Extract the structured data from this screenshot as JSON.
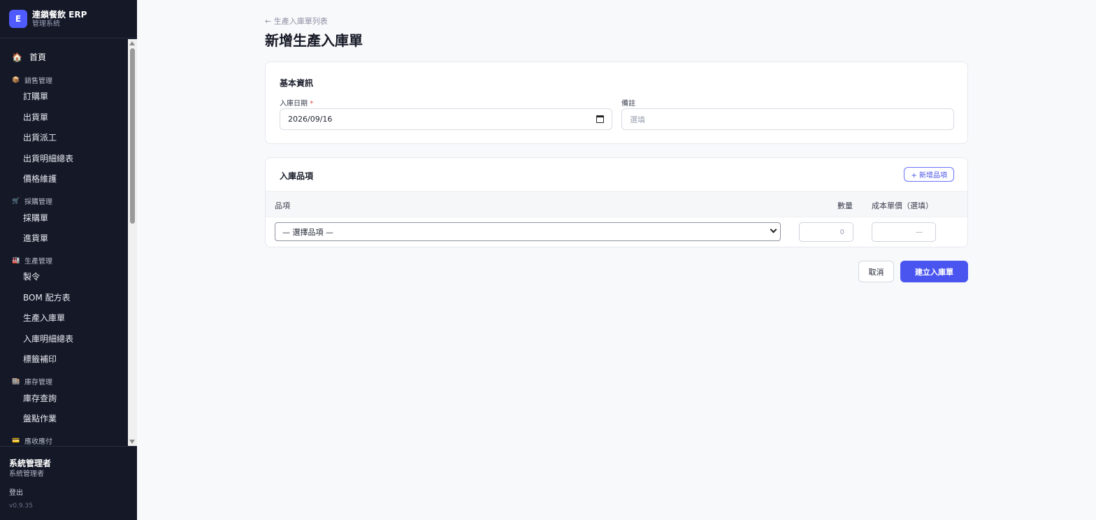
{
  "brand": {
    "logo": "E",
    "title": "連鎖餐飲 ERP",
    "subtitle": "管理系統"
  },
  "nav": {
    "home": {
      "icon": "home-icon",
      "label": "首頁"
    },
    "groups": [
      {
        "icon": "box-icon",
        "label": "銷售管理",
        "items": [
          "訂購單",
          "出貨單",
          "出貨派工",
          "出貨明細總表",
          "價格維護"
        ]
      },
      {
        "icon": "cart-icon",
        "label": "採購管理",
        "items": [
          "採購單",
          "進貨單"
        ]
      },
      {
        "icon": "factory-icon",
        "label": "生產管理",
        "items": [
          "製令",
          "BOM 配方表",
          "生產入庫單",
          "入庫明細總表",
          "標籤補印"
        ]
      },
      {
        "icon": "warehouse-icon",
        "label": "庫存管理",
        "items": [
          "庫存查詢",
          "盤點作業"
        ]
      },
      {
        "icon": "card-icon",
        "label": "應收應付",
        "items": []
      }
    ]
  },
  "user": {
    "name": "系統管理者",
    "role": "系統管理者",
    "logout": "登出",
    "version": "v0.9.35"
  },
  "header": {
    "back": "← 生產入庫單列表",
    "title": "新增生產入庫單"
  },
  "basic": {
    "title": "基本資訊",
    "date_label": "入庫日期",
    "required_mark": "*",
    "date_value": "2026/09/16",
    "note_label": "備註",
    "note_placeholder": "選填"
  },
  "items": {
    "title": "入庫品項",
    "add_button": "+ 新增品項",
    "columns": {
      "item": "品項",
      "qty": "數量",
      "cost": "成本單價（選填）"
    },
    "row": {
      "item_select": "— 選擇品項 —",
      "qty_placeholder": "0",
      "cost_placeholder": "—"
    }
  },
  "actions": {
    "cancel": "取消",
    "submit": "建立入庫單"
  },
  "colors": {
    "sidebar_bg": "#141827",
    "accent": "#4a55f0",
    "page_bg": "#f8f9fb"
  }
}
